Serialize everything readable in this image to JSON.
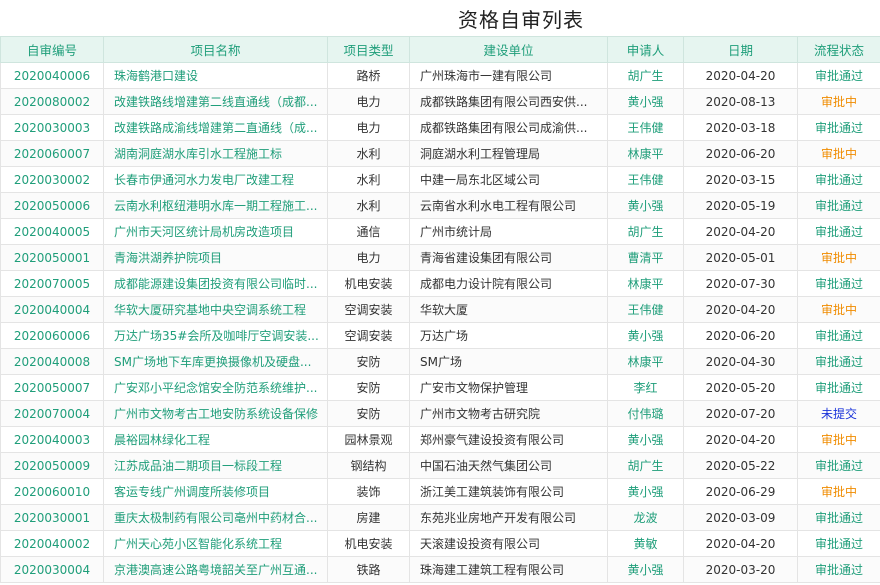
{
  "page": {
    "title": "资格自审列表"
  },
  "columns": [
    "自审编号",
    "项目名称",
    "项目类型",
    "建设单位",
    "申请人",
    "日期",
    "流程状态"
  ],
  "colors": {
    "accent": "#1f9e7a",
    "pending": "#f08c00",
    "unsubmitted": "#1a33d9",
    "header_bg": "#e6f5f0"
  },
  "rows": [
    {
      "code": "2020040006",
      "name": "珠海鹤港口建设",
      "type": "路桥",
      "unit": "广州珠海市一建有限公司",
      "applicant": "胡广生",
      "date": "2020-04-20",
      "status": "审批通过",
      "status_kind": "pass"
    },
    {
      "code": "2020080002",
      "name": "改建铁路线增建第二线直通线（成都...",
      "type": "电力",
      "unit": "成都铁路集团有限公司西安供...",
      "applicant": "黄小强",
      "date": "2020-08-13",
      "status": "审批中",
      "status_kind": "wait"
    },
    {
      "code": "2020030003",
      "name": "改建铁路成渝线增建第二直通线（成...",
      "type": "电力",
      "unit": "成都铁路集团有限公司成渝供...",
      "applicant": "王伟健",
      "date": "2020-03-18",
      "status": "审批通过",
      "status_kind": "pass"
    },
    {
      "code": "2020060007",
      "name": "湖南洞庭湖水库引水工程施工标",
      "type": "水利",
      "unit": "洞庭湖水利工程管理局",
      "applicant": "林康平",
      "date": "2020-06-20",
      "status": "审批中",
      "status_kind": "wait"
    },
    {
      "code": "2020030002",
      "name": "长春市伊通河水力发电厂改建工程",
      "type": "水利",
      "unit": "中建一局东北区域公司",
      "applicant": "王伟健",
      "date": "2020-03-15",
      "status": "审批通过",
      "status_kind": "pass"
    },
    {
      "code": "2020050006",
      "name": "云南水利枢纽港明水库一期工程施工...",
      "type": "水利",
      "unit": "云南省水利水电工程有限公司",
      "applicant": "黄小强",
      "date": "2020-05-19",
      "status": "审批通过",
      "status_kind": "pass"
    },
    {
      "code": "2020040005",
      "name": "广州市天河区统计局机房改造项目",
      "type": "通信",
      "unit": "广州市统计局",
      "applicant": "胡广生",
      "date": "2020-04-20",
      "status": "审批通过",
      "status_kind": "pass"
    },
    {
      "code": "2020050001",
      "name": "青海洪湖养护院项目",
      "type": "电力",
      "unit": "青海省建设集团有限公司",
      "applicant": "曹清平",
      "date": "2020-05-01",
      "status": "审批中",
      "status_kind": "wait"
    },
    {
      "code": "2020070005",
      "name": "成都能源建设集团投资有限公司临时...",
      "type": "机电安装",
      "unit": "成都电力设计院有限公司",
      "applicant": "林康平",
      "date": "2020-07-30",
      "status": "审批通过",
      "status_kind": "pass"
    },
    {
      "code": "2020040004",
      "name": "华软大厦研究基地中央空调系统工程",
      "type": "空调安装",
      "unit": "华软大厦",
      "applicant": "王伟健",
      "date": "2020-04-20",
      "status": "审批中",
      "status_kind": "wait"
    },
    {
      "code": "2020060006",
      "name": "万达广场35#会所及咖啡厅空调安装...",
      "type": "空调安装",
      "unit": "万达广场",
      "applicant": "黄小强",
      "date": "2020-06-20",
      "status": "审批通过",
      "status_kind": "pass"
    },
    {
      "code": "2020040008",
      "name": "SM广场地下车库更换摄像机及硬盘...",
      "type": "安防",
      "unit": "SM广场",
      "applicant": "林康平",
      "date": "2020-04-30",
      "status": "审批通过",
      "status_kind": "pass"
    },
    {
      "code": "2020050007",
      "name": "广安邓小平纪念馆安全防范系统维护...",
      "type": "安防",
      "unit": "广安市文物保护管理",
      "applicant": "李红",
      "date": "2020-05-20",
      "status": "审批通过",
      "status_kind": "pass"
    },
    {
      "code": "2020070004",
      "name": "广州市文物考古工地安防系统设备保修",
      "type": "安防",
      "unit": "广州市文物考古研究院",
      "applicant": "付伟璐",
      "date": "2020-07-20",
      "status": "未提交",
      "status_kind": "none"
    },
    {
      "code": "2020040003",
      "name": "晨裕园林绿化工程",
      "type": "园林景观",
      "unit": "郑州豪气建设投资有限公司",
      "applicant": "黄小强",
      "date": "2020-04-20",
      "status": "审批中",
      "status_kind": "wait"
    },
    {
      "code": "2020050009",
      "name": "江苏成品油二期项目一标段工程",
      "type": "钢结构",
      "unit": "中国石油天然气集团公司",
      "applicant": "胡广生",
      "date": "2020-05-22",
      "status": "审批通过",
      "status_kind": "pass"
    },
    {
      "code": "2020060010",
      "name": "客运专线广州调度所装修项目",
      "type": "装饰",
      "unit": "浙江美工建筑装饰有限公司",
      "applicant": "黄小强",
      "date": "2020-06-29",
      "status": "审批中",
      "status_kind": "wait"
    },
    {
      "code": "2020030001",
      "name": "重庆太极制药有限公司亳州中药材合...",
      "type": "房建",
      "unit": "东苑兆业房地产开发有限公司",
      "applicant": "龙波",
      "date": "2020-03-09",
      "status": "审批通过",
      "status_kind": "pass"
    },
    {
      "code": "2020040002",
      "name": "广州天心苑小区智能化系统工程",
      "type": "机电安装",
      "unit": "天滚建设投资有限公司",
      "applicant": "黄敏",
      "date": "2020-04-20",
      "status": "审批通过",
      "status_kind": "pass"
    },
    {
      "code": "2020030004",
      "name": "京港澳高速公路粤境韶关至广州互通...",
      "type": "铁路",
      "unit": "珠海建工建筑工程有限公司",
      "applicant": "黄小强",
      "date": "2020-03-20",
      "status": "审批通过",
      "status_kind": "pass"
    }
  ]
}
